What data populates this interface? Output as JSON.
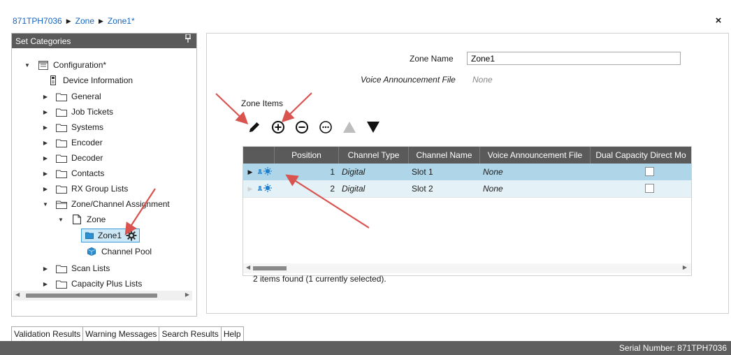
{
  "breadcrumb": [
    "871TPH7036",
    "Zone",
    "Zone1*"
  ],
  "close_label": "×",
  "left_panel": {
    "title": "Set Categories",
    "pin_icon": "pin-icon",
    "tree": [
      {
        "label": "Configuration*",
        "icon": "configuration-icon",
        "expander": "expanded"
      },
      {
        "label": "Device Information",
        "icon": "device-icon",
        "expander": "none"
      },
      {
        "label": "General",
        "icon": "folder-icon",
        "expander": "collapsed"
      },
      {
        "label": "Job Tickets",
        "icon": "folder-icon",
        "expander": "collapsed"
      },
      {
        "label": "Systems",
        "icon": "folder-icon",
        "expander": "collapsed"
      },
      {
        "label": "Encoder",
        "icon": "folder-icon",
        "expander": "collapsed"
      },
      {
        "label": "Decoder",
        "icon": "folder-icon",
        "expander": "collapsed"
      },
      {
        "label": "Contacts",
        "icon": "folder-icon",
        "expander": "collapsed"
      },
      {
        "label": "RX Group Lists",
        "icon": "folder-icon",
        "expander": "collapsed"
      },
      {
        "label": "Zone/Channel Assignment",
        "icon": "folder-open-icon",
        "expander": "expanded"
      },
      {
        "label": "Zone",
        "icon": "document-icon",
        "expander": "expanded"
      },
      {
        "label": "Zone1",
        "icon": "zone-item-icon",
        "expander": "none",
        "selected": true
      },
      {
        "label": "Channel Pool",
        "icon": "cube-icon",
        "expander": "none"
      },
      {
        "label": "Scan Lists",
        "icon": "folder-icon",
        "expander": "collapsed"
      },
      {
        "label": "Capacity Plus Lists",
        "icon": "folder-icon",
        "expander": "collapsed"
      }
    ]
  },
  "form": {
    "zone_name_label": "Zone Name",
    "zone_name_value": "Zone1",
    "voice_file_label": "Voice Announcement File",
    "voice_file_value": "None",
    "zone_items_label": "Zone Items"
  },
  "grid": {
    "columns": [
      "Position",
      "Channel Type",
      "Channel Name",
      "Voice Announcement File",
      "Dual Capacity Direct Mo"
    ],
    "rows": [
      {
        "position": "1",
        "type": "Digital",
        "name": "Slot 1",
        "voice": "None",
        "checked": false,
        "selected": true
      },
      {
        "position": "2",
        "type": "Digital",
        "name": "Slot 2",
        "voice": "None",
        "checked": false,
        "selected": false
      }
    ],
    "footer": "2 items found (1 currently selected)."
  },
  "bottom_tabs": [
    "Validation Results",
    "Warning Messages",
    "Search Results",
    "Help"
  ],
  "status": {
    "serial": "Serial Number: 871TPH7036"
  },
  "colors": {
    "header_gray": "#5a5a5a",
    "selected_row": "#aed6e8",
    "alt_row": "#e4f2f8",
    "link_blue": "#1565c0",
    "annotation_red": "#d9534f"
  }
}
